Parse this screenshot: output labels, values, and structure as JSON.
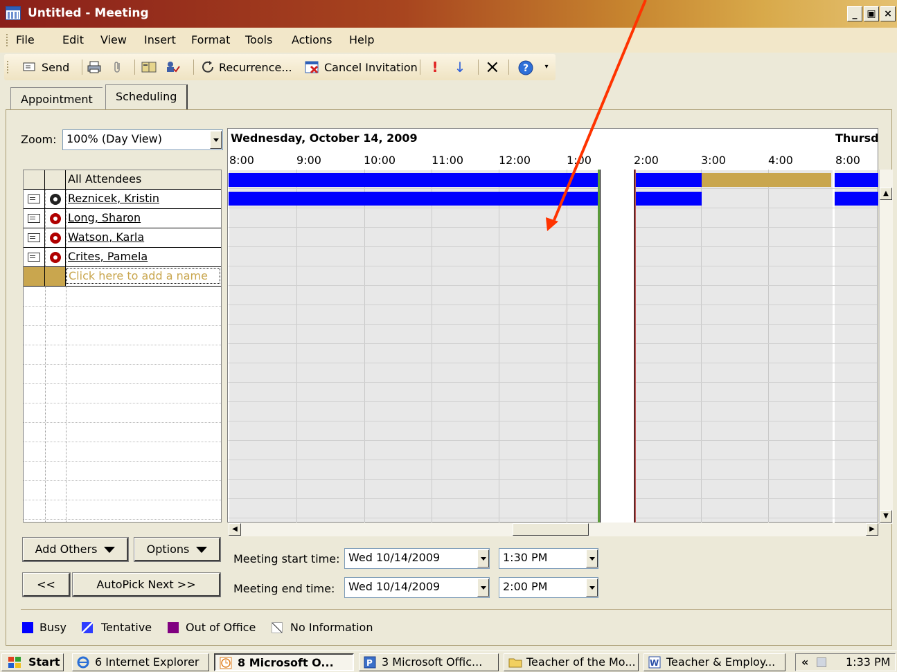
{
  "window": {
    "title": "Untitled - Meeting",
    "minimize": "_",
    "maximize": "▣",
    "close": "×"
  },
  "menu": [
    "File",
    "Edit",
    "View",
    "Insert",
    "Format",
    "Tools",
    "Actions",
    "Help"
  ],
  "toolbar": {
    "send": "Send",
    "recurrence": "Recurrence...",
    "cancel_invitation": "Cancel Invitation",
    "icons": [
      "send-icon",
      "print-icon",
      "attach-icon",
      "address-book-icon",
      "check-names-icon",
      "recurrence-icon",
      "cancel-invitation-icon",
      "importance-high-icon",
      "importance-low-icon",
      "delete-icon",
      "help-icon"
    ]
  },
  "tabs": [
    "Appointment",
    "Scheduling"
  ],
  "zoom": {
    "label": "Zoom:",
    "value": "100% (Day View)"
  },
  "attendees": {
    "header": "All Attendees",
    "rows": [
      {
        "name": "Reznicek, Kristin",
        "status": "organizer"
      },
      {
        "name": "Long, Sharon",
        "status": "required"
      },
      {
        "name": "Watson, Karla",
        "status": "required"
      },
      {
        "name": "Crites, Pamela",
        "status": "required"
      }
    ],
    "add_placeholder": "Click here to add a name"
  },
  "schedule": {
    "date": "Wednesday, October 14, 2009",
    "next_date": "Thursd",
    "hours": [
      "8:00",
      "9:00",
      "10:00",
      "11:00",
      "12:00",
      "1:00",
      "2:00",
      "3:00",
      "4:00",
      "8:00"
    ]
  },
  "buttons": {
    "add_others": "Add Others",
    "options": "Options",
    "prev": "<<",
    "autopick": "AutoPick Next >>"
  },
  "meeting": {
    "start_label": "Meeting start time:",
    "start_date": "Wed 10/14/2009",
    "start_time": "1:30 PM",
    "end_label": "Meeting end time:",
    "end_date": "Wed 10/14/2009",
    "end_time": "2:00 PM"
  },
  "legend": [
    {
      "label": "Busy",
      "color": "#0000ff"
    },
    {
      "label": "Tentative",
      "color": "#2e3cff"
    },
    {
      "label": "Out of Office",
      "color": "#800080"
    },
    {
      "label": "No Information",
      "color": "#ffffff"
    }
  ],
  "taskbar": {
    "start": "Start",
    "tasks": [
      "6 Internet Explorer",
      "8 Microsoft O...",
      "3 Microsoft Offic...",
      "Teacher of the Mo...",
      "Teacher & Employ..."
    ],
    "tray_chevron": "«",
    "clock": "1:33 PM"
  },
  "colors": {
    "busy": "#0000ff",
    "tentative_bar": "#c9a64e",
    "free_area": "#e8e8e8",
    "annotation_arrow": "#ff3300"
  }
}
